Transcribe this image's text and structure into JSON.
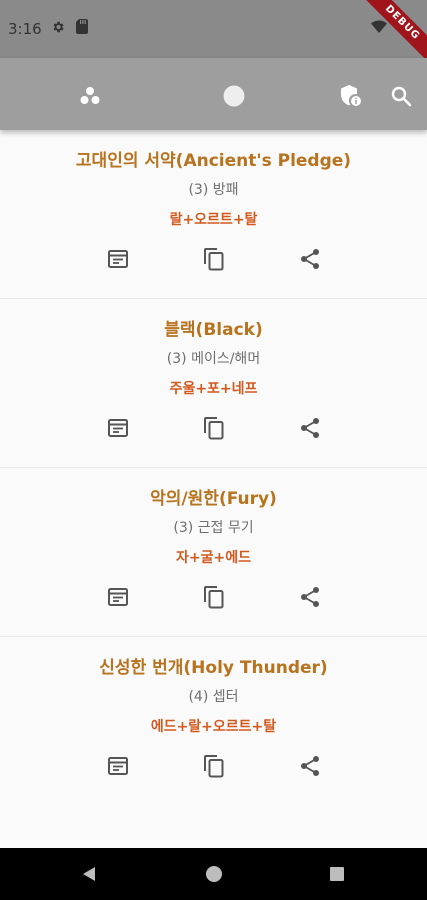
{
  "status_bar": {
    "time": "3:16",
    "debug_label": "DEBUG",
    "icons": [
      "gear-icon",
      "sd-card-icon",
      "wifi-icon"
    ]
  },
  "app_bar": {
    "icons": [
      "bubbles-icon",
      "circle-icon",
      "shield-info-icon",
      "search-icon"
    ],
    "background_color": "#9e9e9e"
  },
  "runewords": [
    {
      "title": "고대인의 서약(Ancient's Pledge)",
      "subtitle": "(3) 방패",
      "runes": "랄+오르트+탈"
    },
    {
      "title": "블랙(Black)",
      "subtitle": "(3) 메이스/해머",
      "runes": "주울+포+네프"
    },
    {
      "title": "악의/원한(Fury)",
      "subtitle": "(3) 근접 무기",
      "runes": "자+굴+에드"
    },
    {
      "title": "신성한 번개(Holy Thunder)",
      "subtitle": "(4) 셉터",
      "runes": "에드+랄+오르트+탈"
    }
  ],
  "colors": {
    "title": "#b8731e",
    "runes": "#d35a1f",
    "subtitle": "#6f6f6f"
  },
  "card_actions": [
    "info-icon",
    "copy-icon",
    "share-icon"
  ],
  "nav_bar": {
    "icons": [
      "back-icon",
      "home-icon",
      "recents-icon"
    ]
  }
}
